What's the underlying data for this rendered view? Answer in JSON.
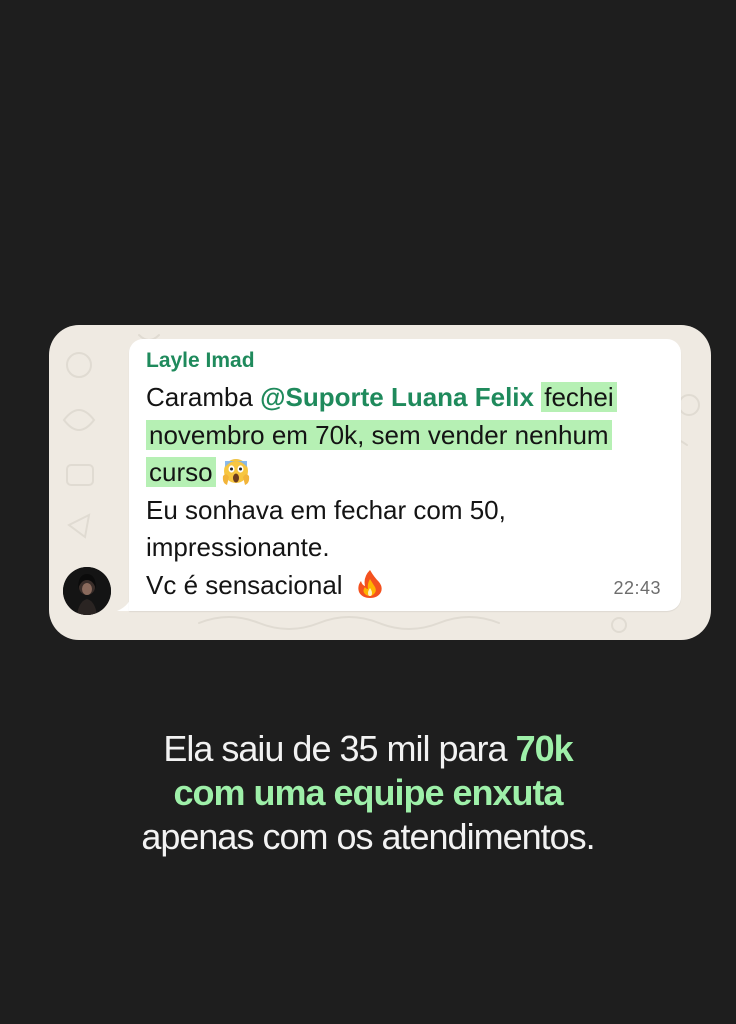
{
  "message": {
    "sender": "Layle Imad",
    "line1_prefix": "Caramba ",
    "mention": "@Suporte Luana Felix",
    "highlight_part1": "fechei",
    "highlight_part2": "novembro em 70k, sem vender nenhum",
    "highlight_part3": "curso",
    "emoji_scream": "😱",
    "line4": "Eu sonhava em fechar com 50,",
    "line5": "impressionante.",
    "line6": "Vc é sensacional",
    "emoji_fire": "🔥",
    "time": "22:43"
  },
  "caption": {
    "part1": "Ela saiu de 35 mil para ",
    "highlight1": "70k",
    "highlight2": "com uma equipe enxuta",
    "part2": "apenas com os atendimentos."
  },
  "colors": {
    "background": "#1e1e1e",
    "chat_wallpaper": "#efeae2",
    "sender_green": "#1f8a5c",
    "highlight_green": "#b6f0b4",
    "caption_green": "#9ef0a9"
  },
  "icons": {
    "avatar": "profile-photo",
    "scream": "face-screaming-in-fear-emoji",
    "fire": "fire-emoji"
  }
}
